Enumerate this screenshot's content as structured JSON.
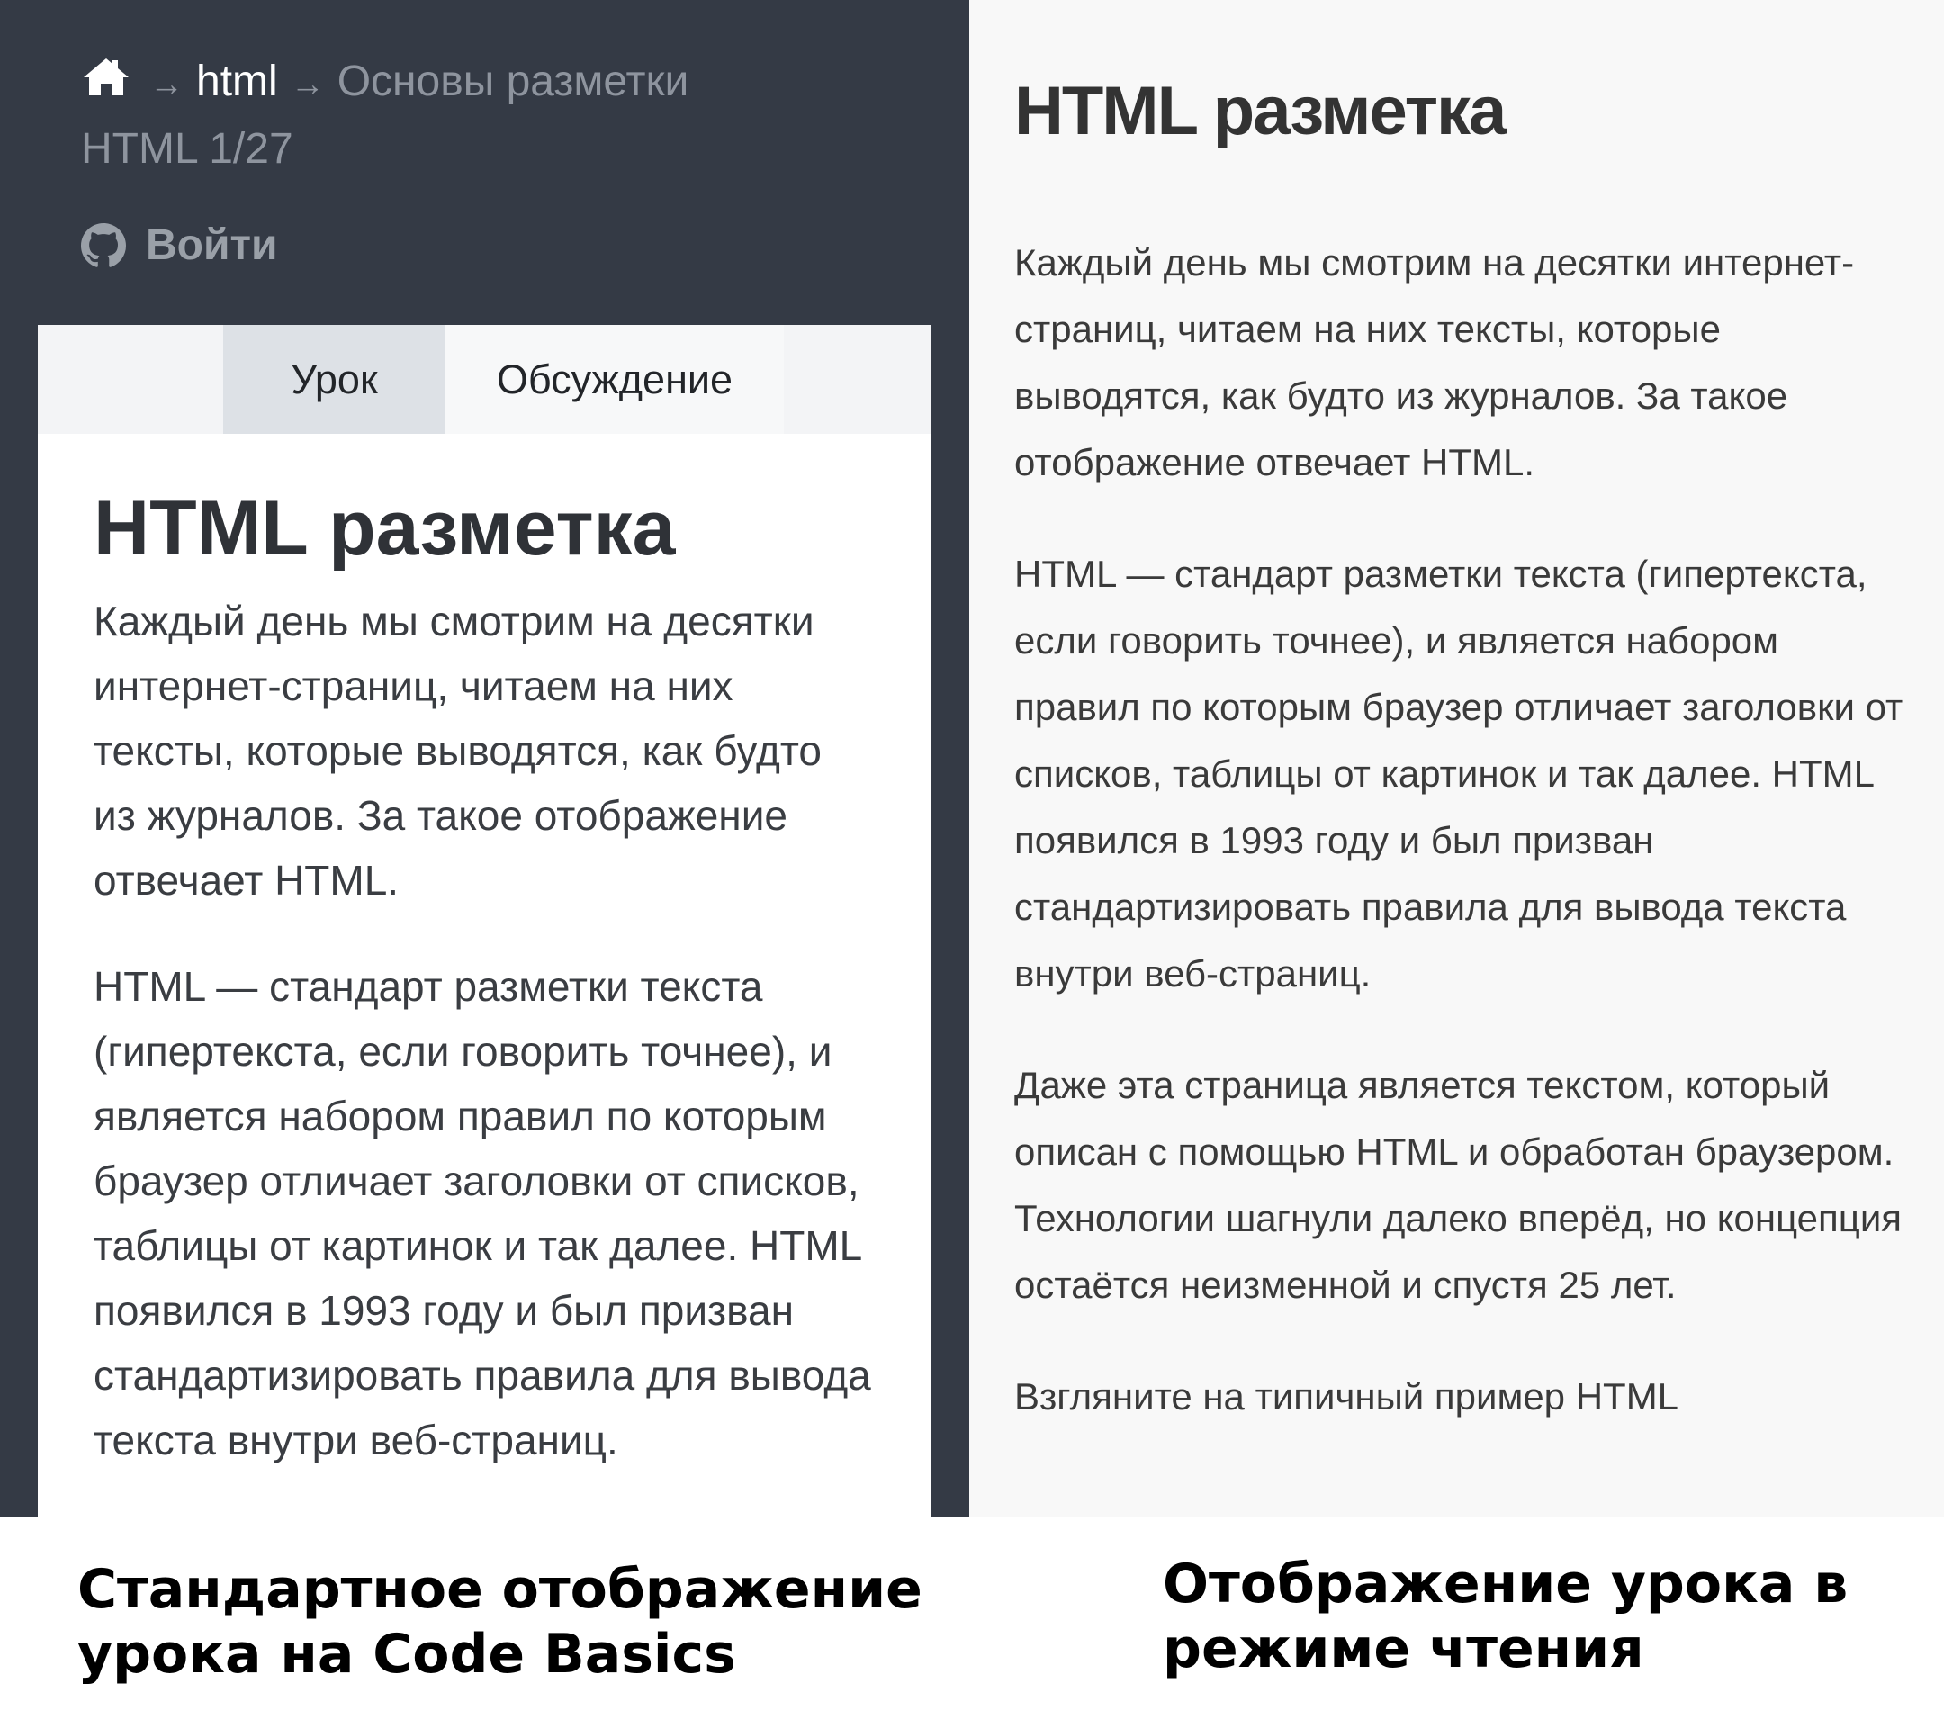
{
  "left_panel": {
    "breadcrumb": {
      "home_icon": "home-icon",
      "arrow": "→",
      "section": "html",
      "current_line1": "Основы разметки",
      "current_line2": "HTML 1/27"
    },
    "login": {
      "icon": "github-icon",
      "label": "Войти"
    },
    "tabs": [
      {
        "label": "Урок",
        "active": true
      },
      {
        "label": "Обсуждение",
        "active": false
      }
    ],
    "lesson": {
      "title": "HTML разметка",
      "paragraphs": [
        "Каждый день мы смотрим на десятки интернет-страниц, читаем на них тексты, которые выводятся, как будто из журналов. За такое отображение отвечает HTML.",
        "HTML — стандарт разметки текста (гипертекста, если говорить точнее), и является набором правил по которым браузер отличает заголовки от списков, таблицы от картинок и так далее. HTML появился в 1993 году и был призван стандартизировать правила для вывода текста внутри веб-страниц."
      ]
    }
  },
  "right_panel": {
    "title": "HTML разметка",
    "paragraphs": [
      "Каждый день мы смотрим на десятки интернет-страниц, читаем на них тексты, которые выводятся, как будто из журналов. За такое отображение отвечает HTML.",
      "HTML — стандарт разметки текста (гипертекста, если говорить точнее), и является набором правил по которым браузер отличает заголовки от списков, таблицы от картинок и так далее. HTML появился в 1993 году и был призван стандартизировать правила для вывода текста внутри веб-страниц.",
      "Даже эта страница является текстом, который описан с помощью HTML и обработан браузером. Технологии шагнули далеко вперёд, но концепция остаётся неизменной и спустя 25 лет.",
      "Взгляните на типичный пример HTML"
    ]
  },
  "captions": {
    "left": "Стандартное отображение урока на Code Basics",
    "right": "Отображение урока в режиме чтения"
  },
  "colors": {
    "header_bg": "#343a45",
    "reader_bg": "#f8f8f8",
    "active_tab_bg": "#dde1e6"
  }
}
